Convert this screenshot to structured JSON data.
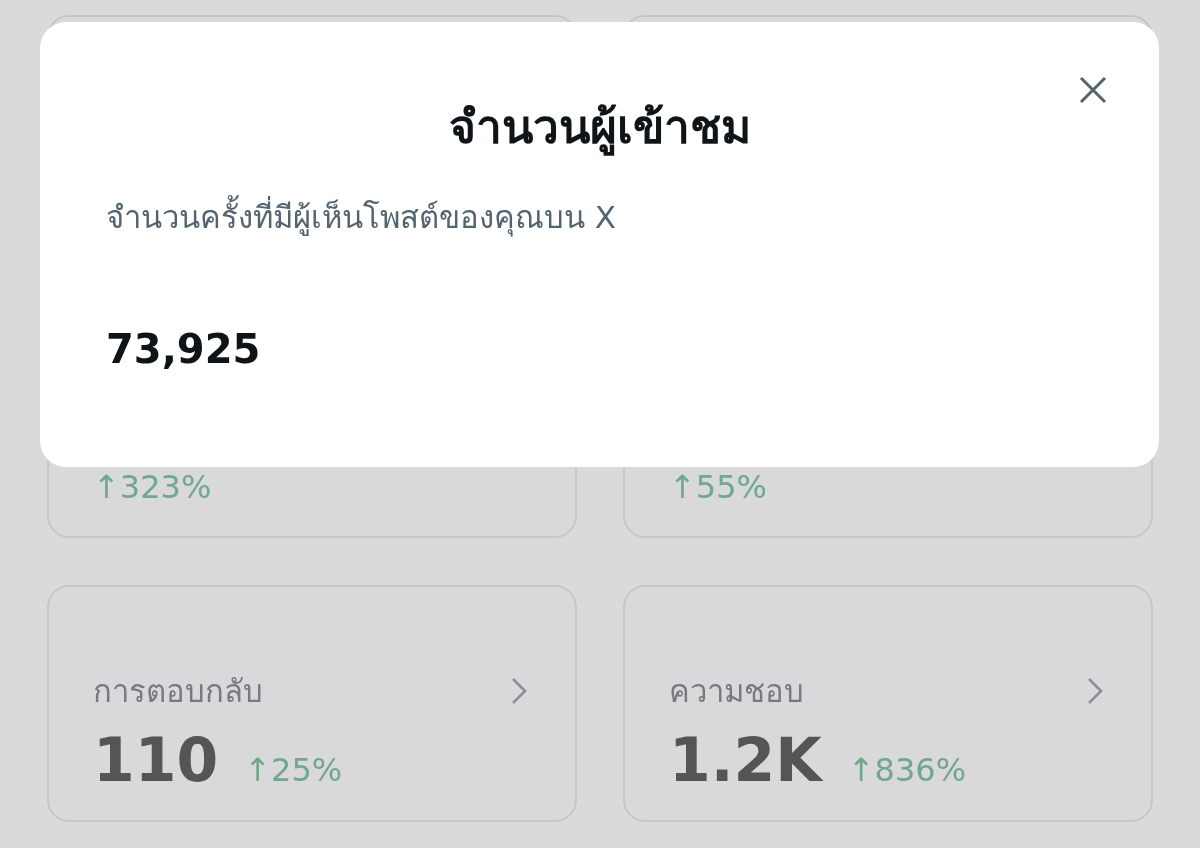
{
  "dialog": {
    "title": "จำนวนผู้เข้าชม",
    "description": "จำนวนครั้งที่มีผู้เห็นโพสต์ของคุณบน X",
    "value": "73,925"
  },
  "metrics": [
    {
      "change": "↑323%"
    },
    {
      "change": "↑55%"
    },
    {
      "label": "การตอบกลับ",
      "value": "110",
      "change": "↑25%"
    },
    {
      "label": "ความชอบ",
      "value": "1.2K",
      "change": "↑836%"
    }
  ]
}
